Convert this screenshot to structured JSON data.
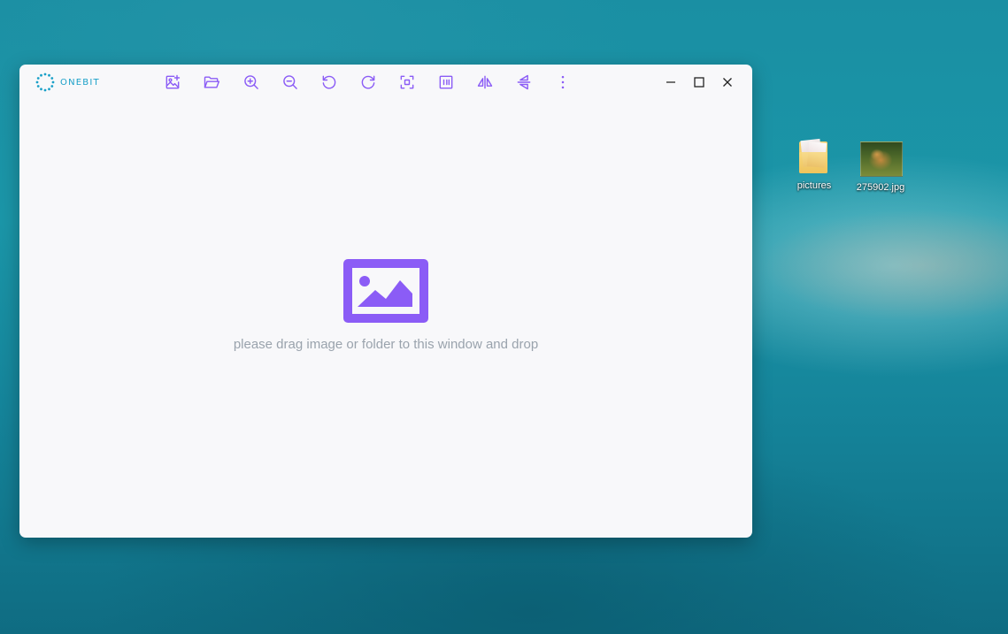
{
  "desktop": {
    "icons": [
      {
        "label": "pictures",
        "icon": "folder-icon"
      },
      {
        "label": "275902.jpg",
        "icon": "image-file-icon"
      }
    ]
  },
  "app": {
    "name": "ONEBIT",
    "accent_color": "#8b5cf6",
    "toolbar": [
      {
        "name": "add-image",
        "icon": "image-plus-icon"
      },
      {
        "name": "open-folder",
        "icon": "folder-open-icon"
      },
      {
        "name": "zoom-in",
        "icon": "zoom-in-icon"
      },
      {
        "name": "zoom-out",
        "icon": "zoom-out-icon"
      },
      {
        "name": "rotate-left",
        "icon": "rotate-ccw-icon"
      },
      {
        "name": "rotate-right",
        "icon": "rotate-cw-icon"
      },
      {
        "name": "fit-to-window",
        "icon": "fit-screen-icon"
      },
      {
        "name": "actual-size",
        "icon": "actual-size-icon"
      },
      {
        "name": "flip-horizontal",
        "icon": "flip-horizontal-icon"
      },
      {
        "name": "flip-vertical",
        "icon": "flip-vertical-icon"
      },
      {
        "name": "more",
        "icon": "more-vertical-icon"
      }
    ],
    "window_controls": [
      "minimize-icon",
      "maximize-icon",
      "close-icon"
    ]
  },
  "main": {
    "placeholder_icon": "image-placeholder-icon",
    "hint": "please drag image or folder to this window and drop"
  }
}
